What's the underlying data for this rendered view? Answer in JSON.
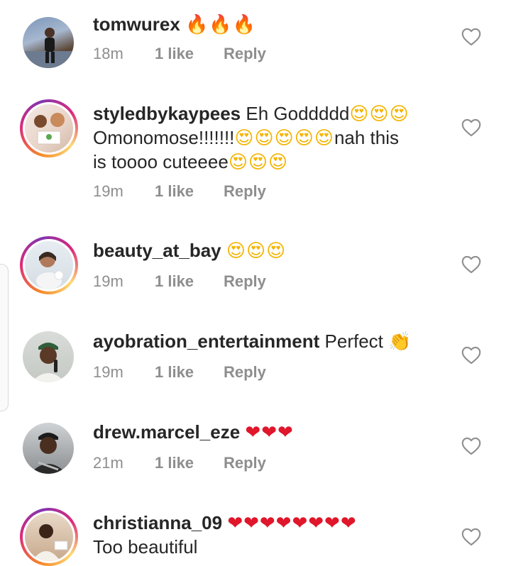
{
  "comments": [
    {
      "username": "tomwurex",
      "text": "",
      "emoji": "🔥🔥🔥",
      "time": "18m",
      "likes": "1 like",
      "reply": "Reply",
      "story_ring": false
    },
    {
      "username": "styledbykaypees",
      "text": "Eh Goddddd",
      "emoji": "😍😍😍",
      "text_line2": "Omonomose!!!!!!!",
      "emoji_line2": "😍😍😍😍😍",
      "text_line2_tail": "nah this",
      "text_line3": "is toooo cuteeee",
      "emoji_line3": "😍😍😍",
      "time": "19m",
      "likes": "1 like",
      "reply": "Reply",
      "story_ring": true
    },
    {
      "username": "beauty_at_bay",
      "text": "",
      "emoji": "😍😍😍",
      "time": "19m",
      "likes": "1 like",
      "reply": "Reply",
      "story_ring": true
    },
    {
      "username": "ayobration_entertainment",
      "text": "Perfect",
      "emoji": "👏",
      "time": "19m",
      "likes": "1 like",
      "reply": "Reply",
      "story_ring": false
    },
    {
      "username": "drew.marcel_eze",
      "text": "",
      "emoji": "❤❤❤",
      "time": "21m",
      "likes": "1 like",
      "reply": "Reply",
      "story_ring": false
    },
    {
      "username": "christianna_09",
      "text": "",
      "emoji": "❤❤❤❤❤❤❤❤",
      "text_line2": "Too beautiful",
      "story_ring": true
    }
  ],
  "icons": {
    "like": "heart-outline-icon"
  },
  "colors": {
    "text": "#262626",
    "meta": "#8e8e8e",
    "heart": "#e0162b",
    "ring_start": "#f58529",
    "ring_end": "#dd2a7b"
  }
}
